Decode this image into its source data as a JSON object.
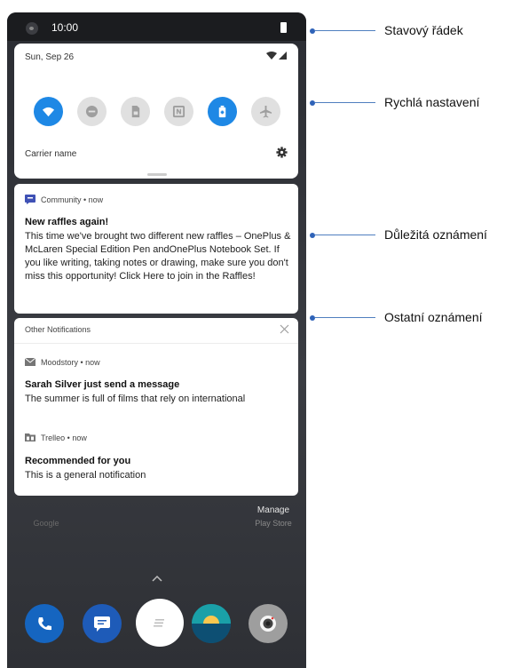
{
  "status_bar": {
    "time": "10:00"
  },
  "quick_settings": {
    "date": "Sun, Sep 26",
    "carrier": "Carrier name",
    "tiles": [
      {
        "icon": "wifi-icon",
        "active": true
      },
      {
        "icon": "do-not-disturb-icon",
        "active": false
      },
      {
        "icon": "sim-card-icon",
        "active": false
      },
      {
        "icon": "nfc-icon",
        "active": false
      },
      {
        "icon": "battery-saver-icon",
        "active": true
      },
      {
        "icon": "airplane-mode-icon",
        "active": false
      }
    ]
  },
  "community_notification": {
    "app": "Community • now",
    "title": "New raffles again!",
    "body": "This time we've brought two different new raffles – OnePlus & McLaren Special Edition Pen andOnePlus Notebook Set. If you like writing, taking notes or drawing, make sure you don't miss this opportunity! Click Here to join in the Raffles!"
  },
  "other_notifications": {
    "header": "Other Notifications",
    "items": [
      {
        "app": "Moodstory • now",
        "title": "Sarah Silver just send a message",
        "body": "The summer is full of films that rely on international"
      },
      {
        "app": "Trelleo • now",
        "title": "Recommended for you",
        "body": "This is a general notification"
      }
    ]
  },
  "home": {
    "manage_label": "Manage",
    "manage_sub": "Play Store",
    "google_label": "Google"
  },
  "callouts": {
    "status_bar": "Stavový řádek",
    "quick_settings": "Rychlá nastavení",
    "important": "Důležitá oznámení",
    "other": "Ostatní oznámení"
  },
  "colors": {
    "accent": "#1e88e5",
    "callout": "#2f63b8",
    "dock_phone": "#1565c0",
    "dock_messages": "#1e5bb8",
    "dock_maps": "#0d6b8f"
  }
}
